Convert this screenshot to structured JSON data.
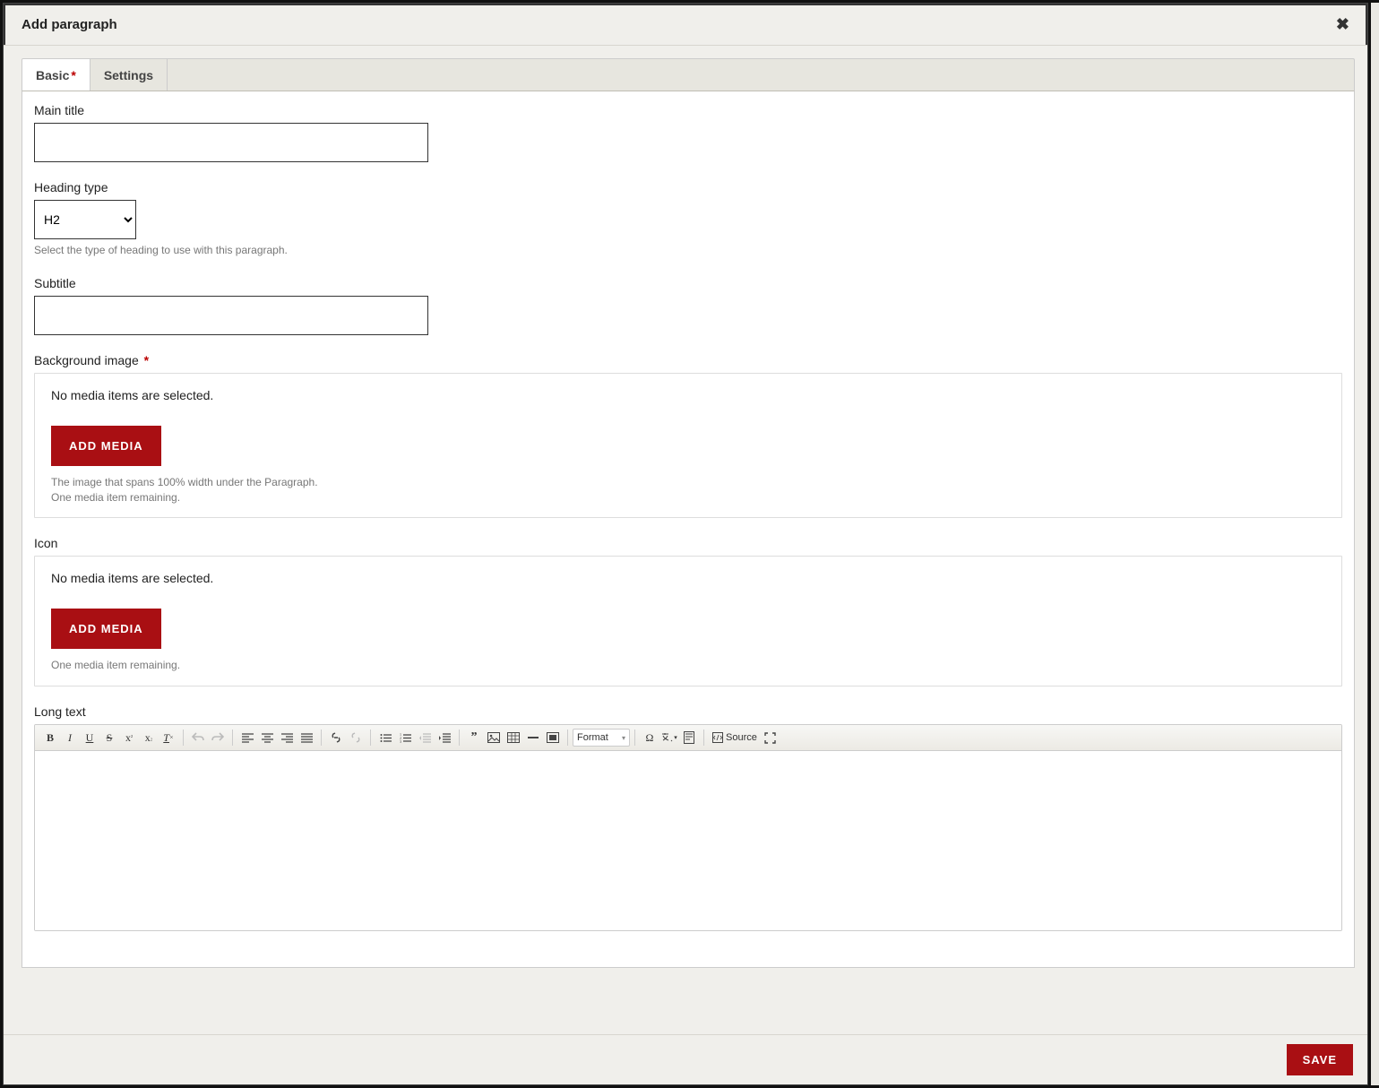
{
  "dialog": {
    "title": "Add paragraph",
    "close_glyph": "✖"
  },
  "tabs": {
    "basic_label": "Basic",
    "settings_label": "Settings"
  },
  "fields": {
    "main_title": {
      "label": "Main title",
      "value": ""
    },
    "heading_type": {
      "label": "Heading type",
      "selected": "H2",
      "help": "Select the type of heading to use with this paragraph."
    },
    "subtitle": {
      "label": "Subtitle",
      "value": ""
    },
    "background_image": {
      "label": "Background image",
      "empty_text": "No media items are selected.",
      "button": "ADD MEDIA",
      "help1": "The image that spans 100% width under the Paragraph.",
      "help2": "One media item remaining."
    },
    "icon": {
      "label": "Icon",
      "empty_text": "No media items are selected.",
      "button": "ADD MEDIA",
      "help": "One media item remaining."
    },
    "long_text": {
      "label": "Long text"
    }
  },
  "editor": {
    "format_label": "Format",
    "source_label": "Source"
  },
  "footer": {
    "save": "SAVE"
  }
}
